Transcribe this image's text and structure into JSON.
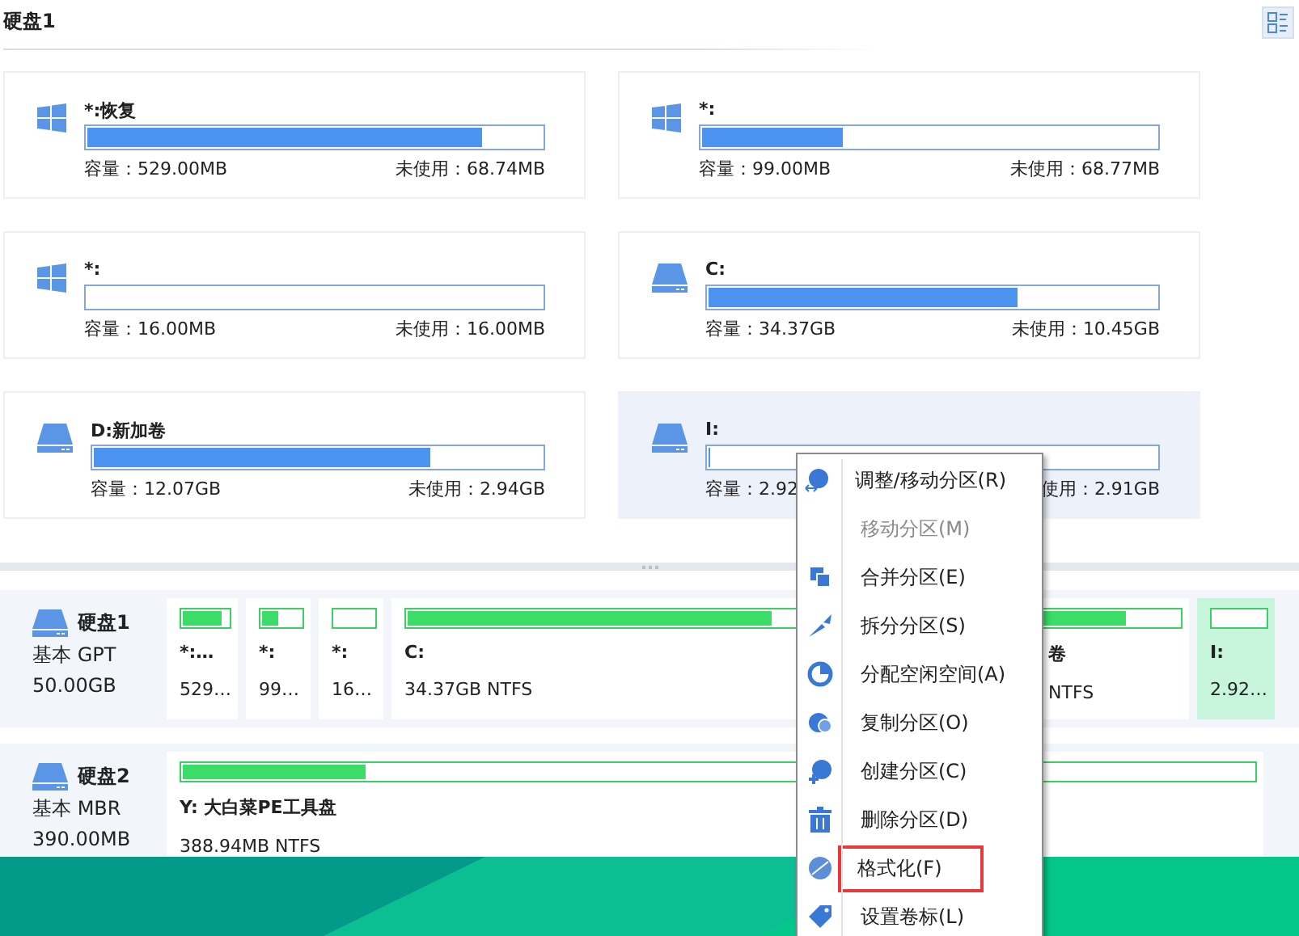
{
  "header": {
    "title": "硬盘1"
  },
  "volumes": [
    {
      "name": "*:恢复",
      "kind": "windows",
      "level": 0.87,
      "capacity": "容量：529.00MB",
      "free": "未使用：68.74MB",
      "selected": false
    },
    {
      "name": "*:",
      "kind": "windows",
      "level": 0.31,
      "capacity": "容量：99.00MB",
      "free": "未使用：68.77MB",
      "selected": false
    },
    {
      "name": "*:",
      "kind": "windows",
      "level": 0,
      "capacity": "容量：16.00MB",
      "free": "未使用：16.00MB",
      "selected": false
    },
    {
      "name": "C:",
      "kind": "drive",
      "level": 0.69,
      "capacity": "容量：34.37GB",
      "free": "未使用：10.45GB",
      "selected": false
    },
    {
      "name": "D:新加卷",
      "kind": "drive",
      "level": 0.75,
      "capacity": "容量：12.07GB",
      "free": "未使用：2.94GB",
      "selected": false
    },
    {
      "name": "I:",
      "kind": "drive",
      "level": 0.004,
      "capacity": "容量：2.92",
      "free": "使用：2.91GB",
      "selected": true
    }
  ],
  "disks": [
    {
      "name": "硬盘1",
      "type": "基本 GPT",
      "size": "50.00GB",
      "partitions": [
        {
          "name": "*:…",
          "info": "529…",
          "level": 0.87,
          "selected": false
        },
        {
          "name": "*:",
          "info": "99…",
          "level": 0.4,
          "selected": false
        },
        {
          "name": "*:",
          "info": "16…",
          "level": 0,
          "selected": false
        },
        {
          "name": "C:",
          "info": "34.37GB NTFS",
          "level": 0.94,
          "selected": false
        },
        {
          "name": "卷",
          "info": "NTFS",
          "level": 0.85,
          "selected": false
        },
        {
          "name": "I:",
          "info": "2.92…",
          "level": 0,
          "selected": true
        }
      ]
    },
    {
      "name": "硬盘2",
      "type": "基本 MBR",
      "size": "390.00MB",
      "partitions": [
        {
          "name": "Y: 大白菜PE工具盘",
          "info": "388.94MB NTFS",
          "level": 0.17,
          "selected": false
        }
      ]
    }
  ],
  "context_menu": [
    {
      "label": "调整/移动分区(R)",
      "kind": "resize",
      "disabled": false,
      "highlighted": false
    },
    {
      "label": "移动分区(M)",
      "kind": "none",
      "disabled": true,
      "highlighted": false
    },
    {
      "label": "合并分区(E)",
      "kind": "merge",
      "disabled": false,
      "highlighted": false
    },
    {
      "label": "拆分分区(S)",
      "kind": "split",
      "disabled": false,
      "highlighted": false
    },
    {
      "label": "分配空闲空间(A)",
      "kind": "allocate",
      "disabled": false,
      "highlighted": false
    },
    {
      "label": "复制分区(O)",
      "kind": "copy",
      "disabled": false,
      "highlighted": false
    },
    {
      "label": "创建分区(C)",
      "kind": "create",
      "disabled": false,
      "highlighted": false
    },
    {
      "label": "删除分区(D)",
      "kind": "delete",
      "disabled": false,
      "highlighted": false
    },
    {
      "label": "格式化(F)",
      "kind": "format",
      "disabled": false,
      "highlighted": true
    },
    {
      "label": "设置卷标(L)",
      "kind": "label",
      "disabled": false,
      "highlighted": false
    }
  ]
}
